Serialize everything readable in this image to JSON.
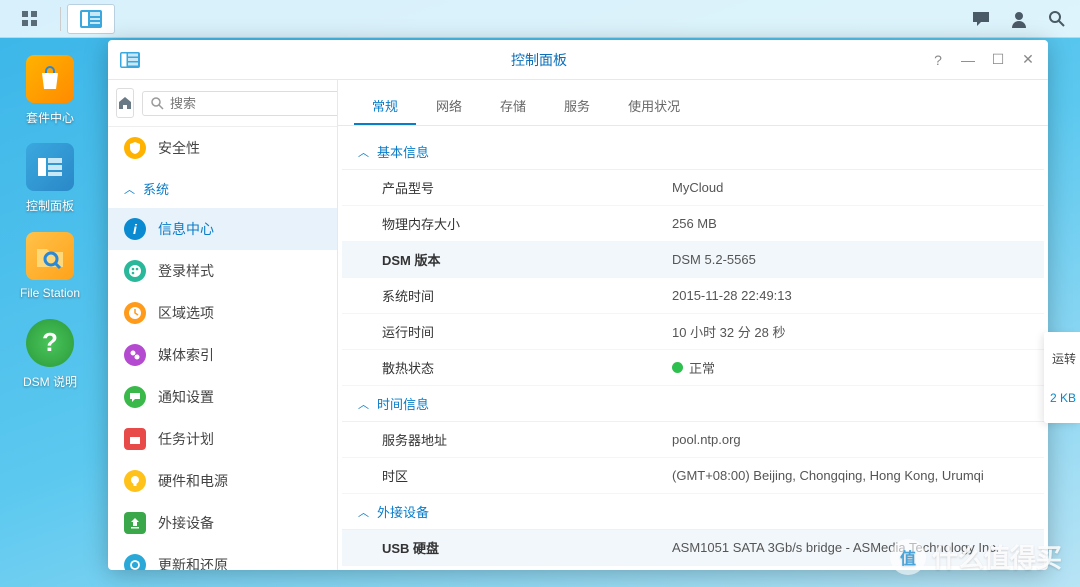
{
  "taskbar": {},
  "desktop": {
    "icons": [
      {
        "label": "套件中心",
        "color": "#ffb300"
      },
      {
        "label": "控制面板",
        "color": "#3aa8de"
      },
      {
        "label": "File Station",
        "color": "#ffb300"
      },
      {
        "label": "DSM 说明",
        "color": "#3bb24a"
      }
    ]
  },
  "window": {
    "title": "控制面板",
    "search_placeholder": "搜索",
    "sidebar": {
      "security": "安全性",
      "group_system": "系统",
      "items": [
        {
          "label": "信息中心"
        },
        {
          "label": "登录样式"
        },
        {
          "label": "区域选项"
        },
        {
          "label": "媒体索引"
        },
        {
          "label": "通知设置"
        },
        {
          "label": "任务计划"
        },
        {
          "label": "硬件和电源"
        },
        {
          "label": "外接设备"
        },
        {
          "label": "更新和还原"
        }
      ]
    },
    "tabs": [
      "常规",
      "网络",
      "存储",
      "服务",
      "使用状况"
    ],
    "sections": {
      "basic": {
        "header": "基本信息",
        "rows": [
          {
            "label": "产品型号",
            "value": "MyCloud"
          },
          {
            "label": "物理内存大小",
            "value": "256 MB"
          },
          {
            "label": "DSM 版本",
            "value": "DSM 5.2-5565",
            "hl": true
          },
          {
            "label": "系统时间",
            "value": "2015-11-28 22:49:13"
          },
          {
            "label": "运行时间",
            "value": "10 小时 32 分 28 秒"
          },
          {
            "label": "散热状态",
            "value": "正常",
            "status": "ok"
          }
        ]
      },
      "time": {
        "header": "时间信息",
        "rows": [
          {
            "label": "服务器地址",
            "value": "pool.ntp.org"
          },
          {
            "label": "时区",
            "value": "(GMT+08:00) Beijing, Chongqing, Hong Kong, Urumqi"
          }
        ]
      },
      "external": {
        "header": "外接设备",
        "rows": [
          {
            "label": "USB 硬盘",
            "value": "ASM1051 SATA 3Gb/s bridge - ASMedia Technology Inc.",
            "hl": true
          }
        ]
      }
    }
  },
  "peek": {
    "r1": "运转",
    "r2": "2 KB"
  },
  "watermark": "什么值得买"
}
